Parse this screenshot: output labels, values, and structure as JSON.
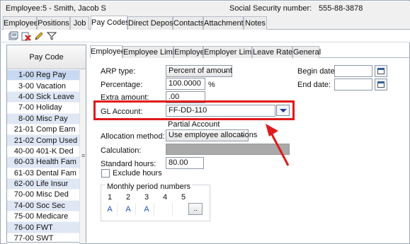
{
  "header": {
    "employee_label": "Employee:",
    "employee_value": "5 - Smith, Jacob S",
    "ssn_label": "Social Security number:",
    "ssn_value": "555-88-3878"
  },
  "main_tabs": [
    "Employee",
    "Positions",
    "Job",
    "Pay Codes",
    "Direct Deposit",
    "Contacts",
    "Attachments",
    "Notes"
  ],
  "active_main_tab": "Pay Codes",
  "toolbar": {
    "icons": [
      "new-record-icon",
      "delete-icon",
      "edit-pencil-icon",
      "filter-icon"
    ]
  },
  "pay_code_list": {
    "header": "Pay Code",
    "items": [
      {
        "code": "1-00",
        "name": "Reg Pay"
      },
      {
        "code": "3-00",
        "name": "Vacation"
      },
      {
        "code": "4-00",
        "name": "Sick Leave"
      },
      {
        "code": "7-00",
        "name": "Holiday"
      },
      {
        "code": "8-00",
        "name": "Misc Pay"
      },
      {
        "code": "21-01",
        "name": "Comp Earn"
      },
      {
        "code": "21-02",
        "name": "Comp Used"
      },
      {
        "code": "40-00",
        "name": "401-K Ded"
      },
      {
        "code": "60-03",
        "name": "Health Fam"
      },
      {
        "code": "61-03",
        "name": "Dental Fam"
      },
      {
        "code": "62-00",
        "name": "Life Insur"
      },
      {
        "code": "70-00",
        "name": "Misc Ded"
      },
      {
        "code": "74-00",
        "name": "Soc Sec"
      },
      {
        "code": "75-00",
        "name": "Medicare"
      },
      {
        "code": "76-00",
        "name": "FWT"
      },
      {
        "code": "77-00",
        "name": "SWT"
      }
    ],
    "splitter_glyph": "≡"
  },
  "sub_tabs": [
    "Employee",
    "Employee Limits",
    "Employer",
    "Employer Limits",
    "Leave Rates",
    "General"
  ],
  "active_sub_tab": "Employee",
  "form": {
    "arp_type_label": "ARP type:",
    "arp_type_value": "Percent of amount",
    "percentage_label": "Percentage:",
    "percentage_value": "100.0000",
    "percentage_unit": "%",
    "extra_amount_label": "Extra amount:",
    "extra_amount_value": ".00",
    "gl_account_label": "GL Account:",
    "gl_account_value": "FF-DD-110",
    "partial_account_text": "Partial Account",
    "allocation_method_label": "Allocation method:",
    "allocation_method_value": "Use employee allocations",
    "calculation_label": "Calculation:",
    "standard_hours_label": "Standard hours:",
    "standard_hours_value": "80.00",
    "exclude_hours_label": "Exclude hours",
    "begin_date_label": "Begin date:",
    "end_date_label": "End date:",
    "monthly_title": "Monthly period numbers",
    "monthly_numbers": [
      "1",
      "2",
      "3",
      "4",
      "5"
    ],
    "monthly_values": [
      "A",
      "A",
      "A",
      "",
      ""
    ],
    "more_button": ".."
  },
  "colors": {
    "highlight": "#e01a1a",
    "selected_row": "#c8d8f0",
    "alt_row": "#dfe7f5"
  }
}
